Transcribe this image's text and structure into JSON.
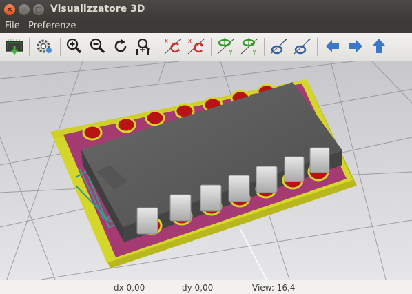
{
  "window": {
    "title": "Visualizzatore 3D",
    "close_glyph": "×",
    "minimize_glyph": "–",
    "maximize_glyph": "□"
  },
  "menu": [
    "File",
    "Preferenze"
  ],
  "toolbar": {
    "buttons": [
      "reload-board-icon",
      "settings-gear-icon",
      "zoom-in-icon",
      "zoom-out-icon",
      "redraw-icon",
      "zoom-fit-icon",
      "rotate-x-cw-icon",
      "rotate-x-ccw-icon",
      "rotate-y-cw-icon",
      "rotate-y-ccw-icon",
      "rotate-z-cw-icon",
      "rotate-z-ccw-icon",
      "move-left-icon",
      "move-right-icon",
      "move-up-icon"
    ],
    "axis_labels": {
      "x": "X",
      "y": "Y",
      "z": "Z"
    }
  },
  "colors": {
    "board_edge": "#d5d62a",
    "soldermask": "#a63a73",
    "copper_pad": "#b81414",
    "ic_body": "#5a5a5a",
    "pin": "#cfcfcf",
    "background": "#dad9dc",
    "accent_blue": "#3a78c9",
    "accent_red": "#cc2d2d",
    "accent_green": "#3a9a2e"
  },
  "status": {
    "dx": "dx 0,00",
    "dy": "dy 0,00",
    "view": "View: 16,4"
  }
}
